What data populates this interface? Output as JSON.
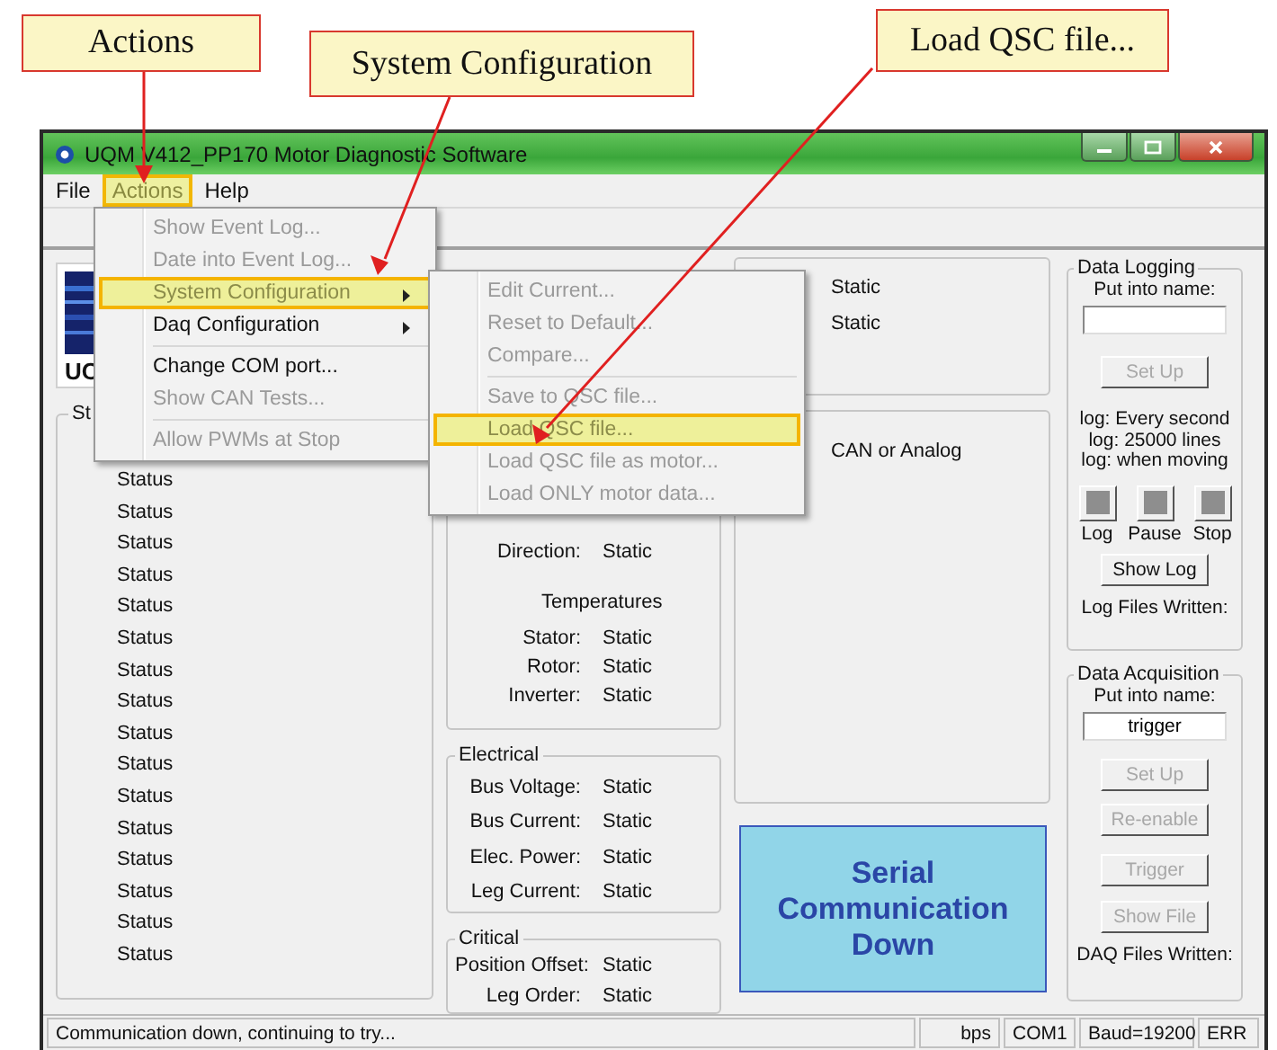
{
  "annotations": [
    {
      "text": "Actions"
    },
    {
      "text": "System Configuration"
    },
    {
      "text": "Load QSC file..."
    }
  ],
  "window": {
    "title": "UQM V412_PP170 Motor Diagnostic Software"
  },
  "menu_bar": [
    {
      "label": "File",
      "selected": false
    },
    {
      "label": "Actions",
      "selected": true
    },
    {
      "label": "Help",
      "selected": false
    }
  ],
  "actions_menu": [
    {
      "kind": "item",
      "label": "Show Event Log...",
      "disabled": true,
      "selected": false
    },
    {
      "kind": "item",
      "label": "Date into Event Log...",
      "disabled": true,
      "selected": false
    },
    {
      "kind": "item",
      "label": "System Configuration",
      "disabled": false,
      "selected": true,
      "submenu": true
    },
    {
      "kind": "item",
      "label": "Daq Configuration",
      "disabled": false,
      "selected": false,
      "submenu": true
    },
    {
      "kind": "separator"
    },
    {
      "kind": "item",
      "label": "Change COM port...",
      "disabled": false,
      "selected": false
    },
    {
      "kind": "item",
      "label": "Show CAN Tests...",
      "disabled": true,
      "selected": false
    },
    {
      "kind": "separator"
    },
    {
      "kind": "item",
      "label": "Allow PWMs at Stop",
      "disabled": true,
      "selected": false
    }
  ],
  "system_configuration_menu": [
    {
      "kind": "item",
      "label": "Edit Current...",
      "disabled": true,
      "selected": false
    },
    {
      "kind": "item",
      "label": "Reset to Default...",
      "disabled": true,
      "selected": false
    },
    {
      "kind": "item",
      "label": "Compare...",
      "disabled": true,
      "selected": false
    },
    {
      "kind": "separator"
    },
    {
      "kind": "item",
      "label": "Save to QSC file...",
      "disabled": true,
      "selected": false
    },
    {
      "kind": "item",
      "label": "Load QSC file...",
      "disabled": true,
      "selected": true
    },
    {
      "kind": "item",
      "label": "Load QSC file as motor...",
      "disabled": true,
      "selected": false
    },
    {
      "kind": "item",
      "label": "Load ONLY motor data...",
      "disabled": true,
      "selected": false
    }
  ],
  "logo": {
    "text": "UC"
  },
  "status_group": {
    "title": "St",
    "items": [
      "Status",
      "Status",
      "Status",
      "Status",
      "Status",
      "Status",
      "Status",
      "Status",
      "Status",
      "Status",
      "Status",
      "Status",
      "Status",
      "Status",
      "Status",
      "Status"
    ]
  },
  "motion_group": {
    "rows": [
      {
        "kind": "row",
        "label": "Direction:",
        "value": "Static"
      },
      {
        "kind": "heading",
        "label": "Temperatures"
      },
      {
        "kind": "row",
        "label": "Stator:",
        "value": "Static"
      },
      {
        "kind": "row",
        "label": "Rotor:",
        "value": "Static"
      },
      {
        "kind": "row",
        "label": "Inverter:",
        "value": "Static"
      }
    ]
  },
  "electrical_group": {
    "title": "Electrical",
    "rows": [
      {
        "label": "Bus Voltage:",
        "value": "Static"
      },
      {
        "label": "Bus Current:",
        "value": "Static"
      },
      {
        "label": "Elec. Power:",
        "value": "Static"
      },
      {
        "label": "Leg Current:",
        "value": "Static"
      }
    ]
  },
  "critical_group": {
    "title": "Critical",
    "rows": [
      {
        "label": "Position Offset:",
        "value": "Static"
      },
      {
        "label": "Leg Order:",
        "value": "Static"
      }
    ]
  },
  "mode_group": {
    "values": [
      "Static",
      "Static"
    ]
  },
  "input_group": {
    "text": "CAN or Analog"
  },
  "alert": {
    "text": "Serial Communication Down"
  },
  "data_logging": {
    "title": "Data Logging",
    "name_label": "Put into name:",
    "setup_button": {
      "label": "Set Up",
      "disabled": true
    },
    "notes": [
      "log: Every second",
      "log: 25000 lines",
      "log: when moving"
    ],
    "toggles": [
      {
        "label": "Log"
      },
      {
        "label": "Pause"
      },
      {
        "label": "Stop"
      }
    ],
    "show_button": {
      "label": "Show Log",
      "disabled": false
    },
    "files_written": "Log Files Written:"
  },
  "data_acquisition": {
    "title": "Data Acquisition",
    "name_label": "Put into name:",
    "name_value": "trigger",
    "buttons": [
      {
        "label": "Set Up",
        "disabled": true
      },
      {
        "label": "Re-enable",
        "disabled": true
      },
      {
        "label": "Trigger",
        "disabled": true
      },
      {
        "label": "Show File",
        "disabled": true
      }
    ],
    "files_written": "DAQ Files Written:"
  },
  "status_bar": {
    "message": "Communication down, continuing to try...",
    "panes": [
      "bps",
      "COM1",
      "Baud=19200",
      "ERR"
    ]
  }
}
